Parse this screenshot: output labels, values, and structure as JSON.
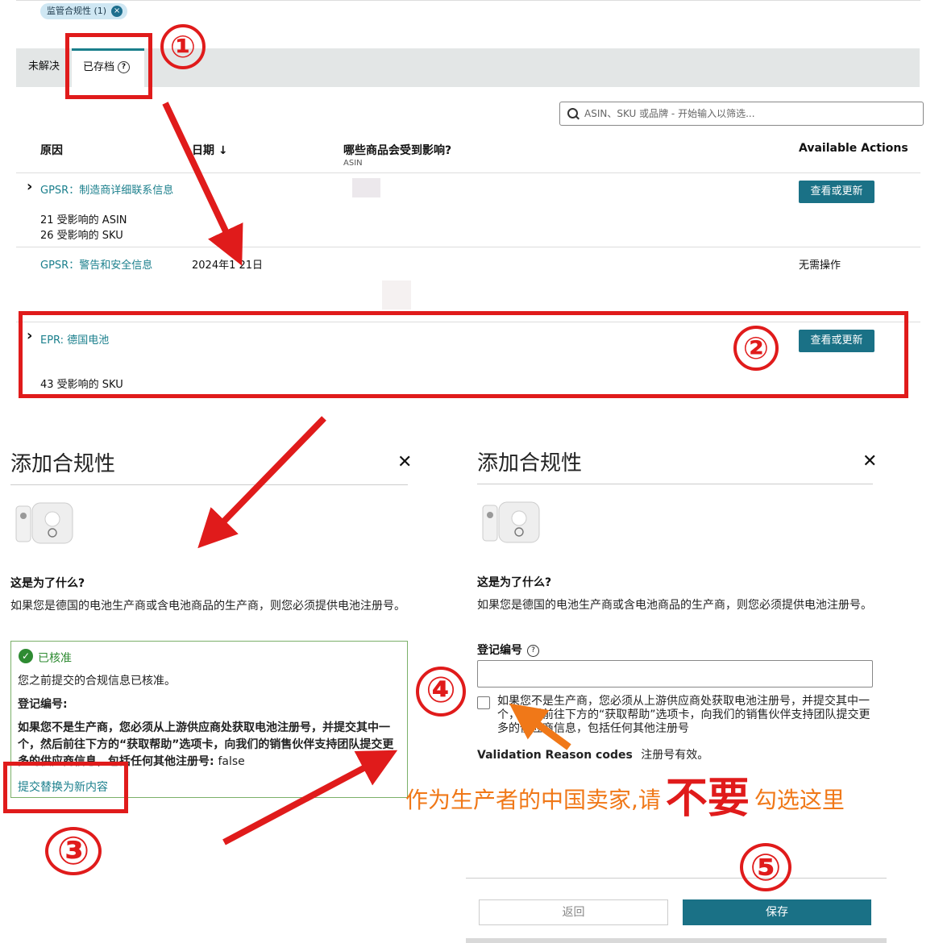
{
  "filter_chip": {
    "label": "监管合规性 (1)"
  },
  "tabs": {
    "unresolved": "未解决",
    "archived": "已存档"
  },
  "search": {
    "placeholder": "ASIN、SKU 或品牌 - 开始输入以筛选..."
  },
  "table": {
    "headers": {
      "reason": "原因",
      "date": "日期",
      "impact": "哪些商品会受到影响?",
      "impact_sub": "ASIN",
      "actions": "Available Actions"
    },
    "rows": [
      {
        "reason": "GPSR：制造商详细联系信息",
        "line1": "21 受影响的 ASIN",
        "line2": "26 受影响的 SKU",
        "action": "查看或更新"
      },
      {
        "reason": "GPSR：警告和安全信息",
        "date": "2024年1   21日",
        "action": "无需操作"
      },
      {
        "reason": "EPR: 德国电池",
        "line1": "43 受影响的 SKU",
        "action": "查看或更新"
      }
    ]
  },
  "annotations": {
    "n1": "①",
    "n2": "②",
    "n3": "③",
    "n4": "④",
    "n5": "⑤",
    "note_prefix": "作为生产者的中国卖家,请",
    "note_big": "不要",
    "note_suffix": "勾选这里"
  },
  "modal_left": {
    "title": "添加合规性",
    "question": "这是为了什么?",
    "desc": "如果您是德国的电池生产商或含电池商品的生产商，则您必须提供电池注册号。",
    "status": "已核准",
    "status_desc": "您之前提交的合规信息已核准。",
    "reg_label": "登记编号:",
    "bold_note": "如果您不是生产商，您必须从上游供应商处获取电池注册号，并提交其中一个，然后前往下方的“获取帮助”选项卡，向我们的销售伙伴支持团队提交更多的供应商信息，包括任何其他注册号:",
    "bold_note_value": "false",
    "replace_link": "提交替换为新内容"
  },
  "modal_right": {
    "title": "添加合规性",
    "question": "这是为了什么?",
    "desc": "如果您是德国的电池生产商或含电池商品的生产商，则您必须提供电池注册号。",
    "reg_label": "登记编号",
    "checkbox_text": "如果您不是生产商，您必须从上游供应商处获取电池注册号，并提交其中一个，然后前往下方的“获取帮助”选项卡，向我们的销售伙伴支持团队提交更多的供应商信息，包括任何其他注册号",
    "validation_label": "Validation Reason codes",
    "validation_value": "注册号有效。",
    "back_button": "返回",
    "save_button": "保存"
  },
  "colors": {
    "accent": "#1a7186",
    "annotation_red": "#e01b1b",
    "annotation_orange": "#f07818",
    "approved_green": "#2e8b32"
  }
}
